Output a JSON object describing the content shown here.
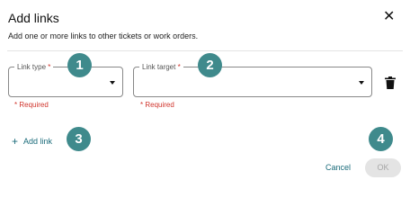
{
  "dialog": {
    "title": "Add links",
    "close_icon": "close-icon",
    "close_glyph": "✕",
    "subtitle": "Add one or more links to other tickets or work orders."
  },
  "fields": {
    "link_type": {
      "label": "Link type",
      "required_mark": "*",
      "value": "",
      "error": "* Required"
    },
    "link_target": {
      "label": "Link target",
      "required_mark": "*",
      "value": "",
      "error": "* Required"
    }
  },
  "row_actions": {
    "delete_icon": "trash-icon"
  },
  "add_link": {
    "icon": "plus-icon",
    "glyph": "+",
    "label": "Add link"
  },
  "footer": {
    "cancel_label": "Cancel",
    "ok_label": "OK",
    "ok_disabled": true
  },
  "callouts": [
    "1",
    "2",
    "3",
    "4"
  ],
  "colors": {
    "accent": "#1a6b7a",
    "error": "#d0342c",
    "callout": "#3f8a8c",
    "disabled_bg": "#e4e4e4",
    "disabled_text": "#a7a7a7"
  }
}
